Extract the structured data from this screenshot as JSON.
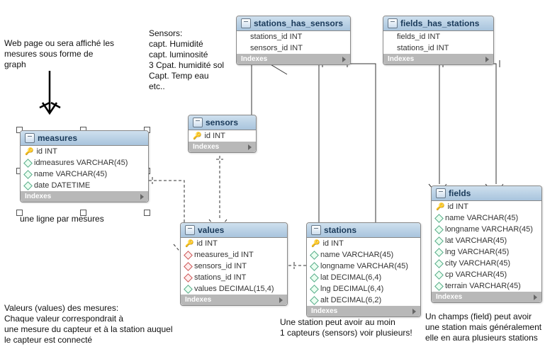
{
  "annotations": {
    "webpage": "Web page ou sera affiché les\nmesures sous forme de\ngraph",
    "sensors_list": "Sensors:\ncapt. Humidité\ncapt. luminosité\n3 Cpat. humidité sol\nCapt. Temp eau\netc..",
    "line_per_measure": "une ligne par mesures",
    "values_note": "Valeurs  (values) des mesures:\nChaque valeur correspondrait à\nune mesure du capteur et à la station auquel\nle capteur est connecté",
    "station_note": "Une station peut avoir au moin\n1 capteurs (sensors) voir plusieurs!",
    "field_note": "Un champs (field) peut avoir\nune station mais généralement\nelle en aura plusieurs stations"
  },
  "indexes_label": "Indexes",
  "entities": {
    "measures": {
      "title": "measures",
      "cols": [
        {
          "icon": "key",
          "text": "id INT"
        },
        {
          "icon": "diamond",
          "text": "idmeasures VARCHAR(45)"
        },
        {
          "icon": "diamond",
          "text": "name VARCHAR(45)"
        },
        {
          "icon": "diamond",
          "text": "date DATETIME"
        }
      ]
    },
    "sensors": {
      "title": "sensors",
      "cols": [
        {
          "icon": "key",
          "text": "id INT"
        }
      ]
    },
    "values": {
      "title": "values",
      "cols": [
        {
          "icon": "key",
          "text": "id INT"
        },
        {
          "icon": "diamond-red",
          "text": "measures_id INT"
        },
        {
          "icon": "diamond-red",
          "text": "sensors_id INT"
        },
        {
          "icon": "diamond-red",
          "text": "stations_id INT"
        },
        {
          "icon": "diamond",
          "text": "values DECIMAL(15,4)"
        }
      ]
    },
    "stations": {
      "title": "stations",
      "cols": [
        {
          "icon": "key",
          "text": "id INT"
        },
        {
          "icon": "diamond",
          "text": "name VARCHAR(45)"
        },
        {
          "icon": "diamond",
          "text": "longname VARCHAR(45)"
        },
        {
          "icon": "diamond",
          "text": "lat DECIMAL(6,4)"
        },
        {
          "icon": "diamond",
          "text": "lng DECIMAL(6,4)"
        },
        {
          "icon": "diamond",
          "text": "alt DECIMAL(6,2)"
        }
      ]
    },
    "stations_has_sensors": {
      "title": "stations_has_sensors",
      "cols": [
        {
          "icon": "none",
          "text": "stations_id INT"
        },
        {
          "icon": "none",
          "text": "sensors_id INT"
        }
      ]
    },
    "fields_has_stations": {
      "title": "fields_has_stations",
      "cols": [
        {
          "icon": "none",
          "text": "fields_id INT"
        },
        {
          "icon": "none",
          "text": "stations_id INT"
        }
      ]
    },
    "fields": {
      "title": "fields",
      "cols": [
        {
          "icon": "key",
          "text": "id INT"
        },
        {
          "icon": "diamond",
          "text": "name VARCHAR(45)"
        },
        {
          "icon": "diamond",
          "text": "longname VARCHAR(45)"
        },
        {
          "icon": "diamond",
          "text": "lat VARCHAR(45)"
        },
        {
          "icon": "diamond",
          "text": "lng VARCHAR(45)"
        },
        {
          "icon": "diamond",
          "text": "city VARCHAR(45)"
        },
        {
          "icon": "diamond",
          "text": "cp VARCHAR(45)"
        },
        {
          "icon": "diamond",
          "text": "terrain VARCHAR(45)"
        }
      ]
    }
  }
}
